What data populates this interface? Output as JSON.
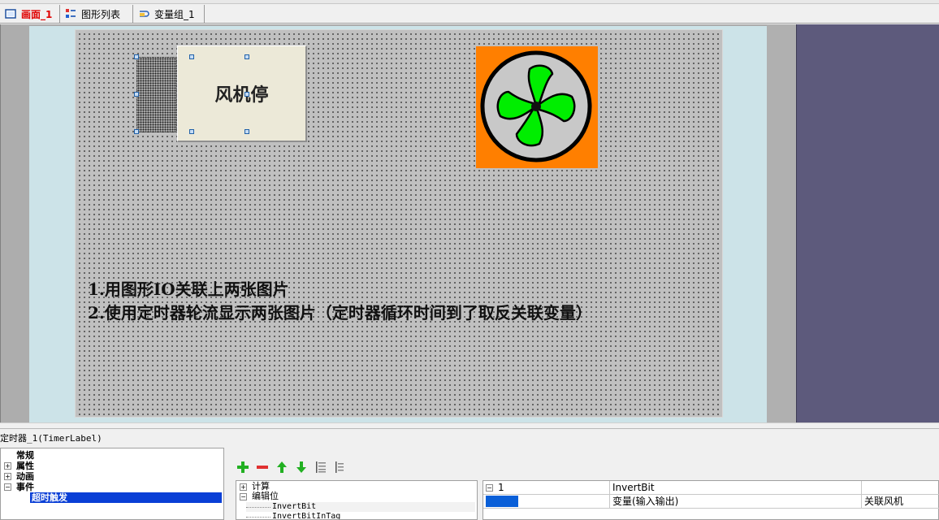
{
  "tabs": [
    {
      "label": "画面_1",
      "icon": "screen-icon",
      "active": true
    },
    {
      "label": "图形列表",
      "icon": "graphics-list-icon",
      "active": false
    },
    {
      "label": "变量组_1",
      "icon": "variable-group-icon",
      "active": false
    }
  ],
  "canvas": {
    "button_label": "风机停",
    "desc_line1": "1.用图形IO关联上两张图片",
    "desc_line2": "2.使用定时器轮流显示两张图片（定时器循环时间到了取反关联变量）",
    "fan_colors": {
      "background": "#ff7f00",
      "blades": "#00ee00",
      "disc": "#c8c8c8"
    }
  },
  "object_title": "定时器_1(TimerLabel)",
  "props_tree": [
    {
      "label": "常规",
      "expander": ""
    },
    {
      "label": "属性",
      "expander": "+"
    },
    {
      "label": "动画",
      "expander": "+"
    },
    {
      "label": "事件",
      "expander": "−"
    },
    {
      "label": "超时触发",
      "expander": "",
      "selected": true
    }
  ],
  "toolbar": [
    "add-icon",
    "remove-icon",
    "move-up-icon",
    "move-down-icon",
    "indent-icon",
    "outdent-icon"
  ],
  "func_tree": [
    {
      "label": "计算",
      "expander": "+"
    },
    {
      "label": "编辑位",
      "expander": "−"
    },
    {
      "label": "InvertBit",
      "expander": ""
    },
    {
      "label": "InvertBitInTag",
      "expander": ""
    }
  ],
  "grid": {
    "row1": {
      "index": "1",
      "expander": "−",
      "value": "InvertBit",
      "extra": ""
    },
    "row2": {
      "name": "变量(输入输出)",
      "value": "关联风机"
    }
  }
}
